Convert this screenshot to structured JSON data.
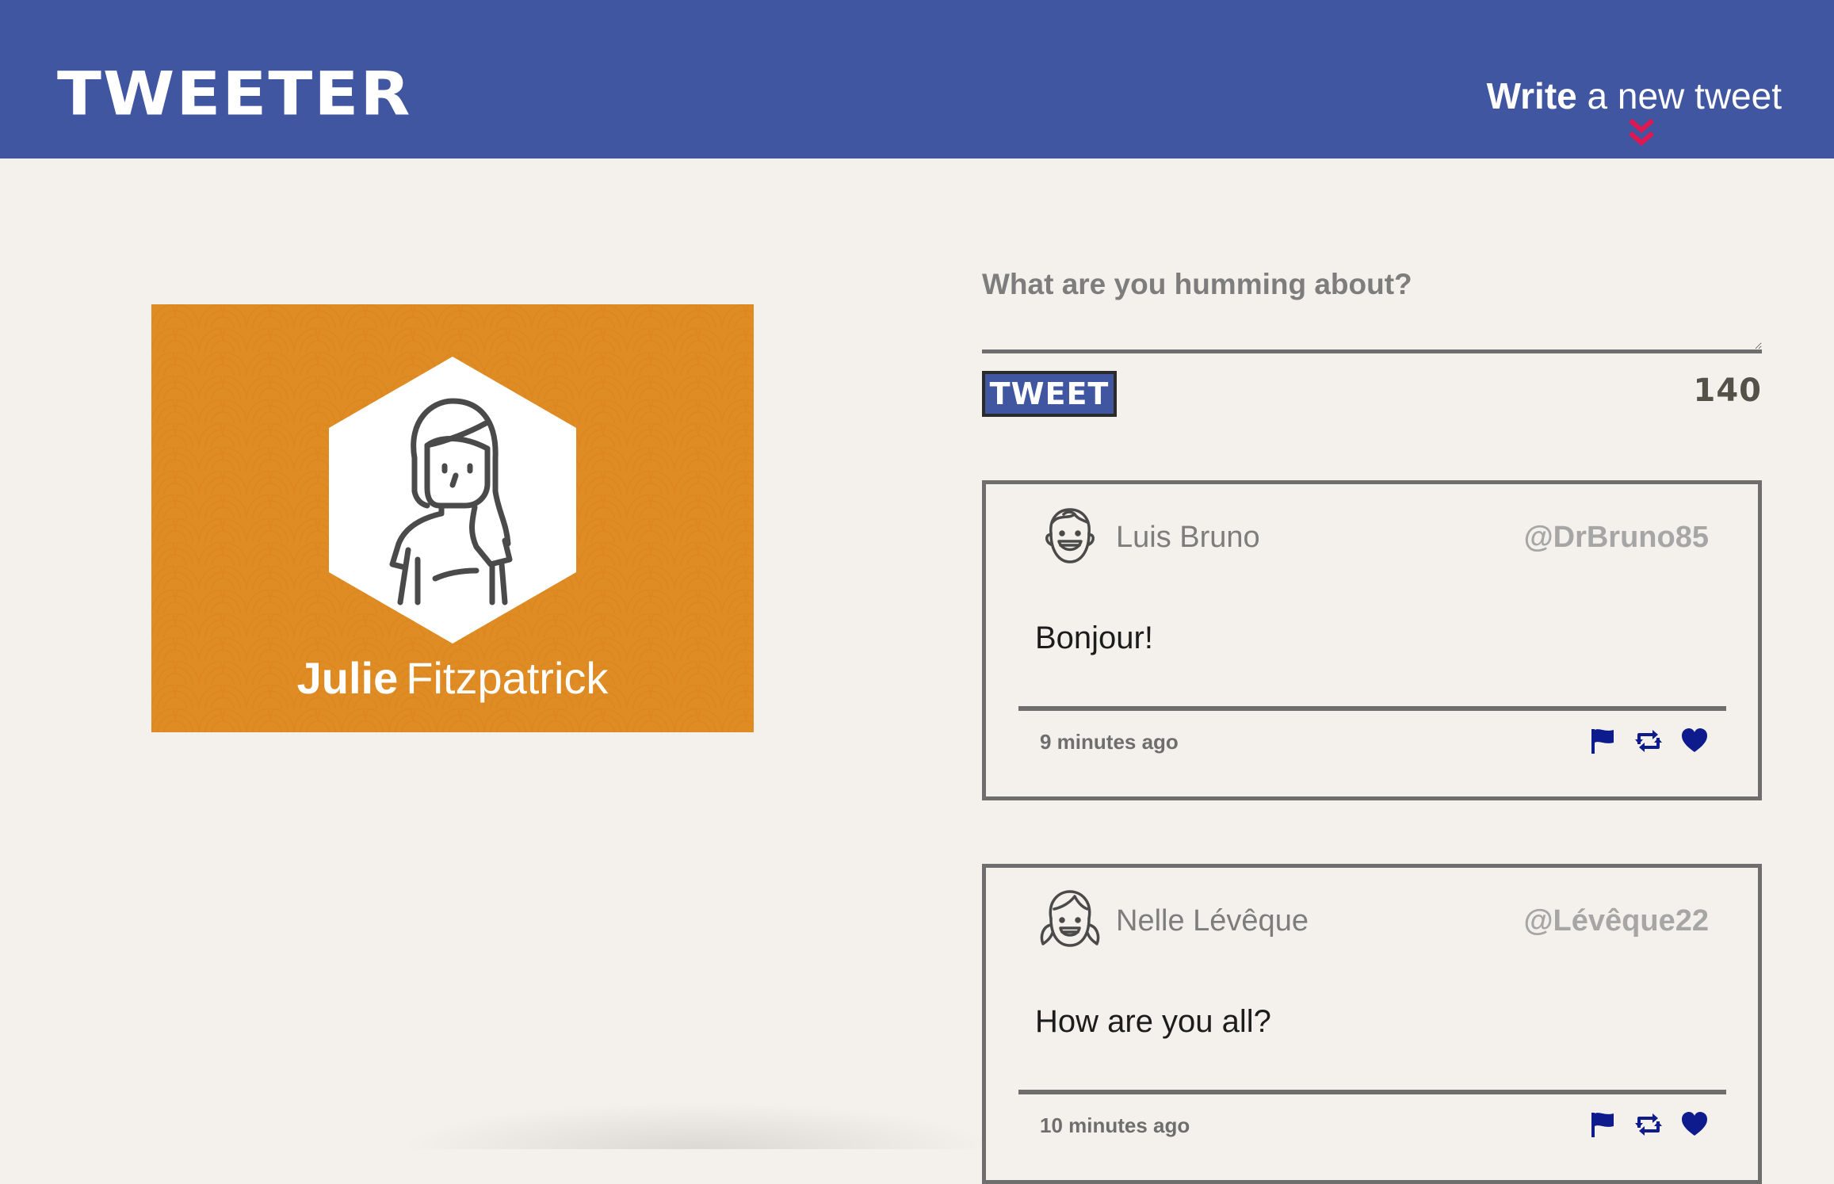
{
  "nav": {
    "logo": "TWEETER",
    "compose_bold": "Write",
    "compose_rest": "a new tweet"
  },
  "profile": {
    "first_name": "Julie",
    "last_name": "Fitzpatrick",
    "avatar_icon": "woman-avatar-icon"
  },
  "new_tweet": {
    "prompt": "What are you humming about?",
    "textarea_value": "",
    "button_label": "TWEET",
    "counter": "140"
  },
  "tweets": [
    {
      "name": "Luis Bruno",
      "handle": "@DrBruno85",
      "text": "Bonjour!",
      "time": "9 minutes ago",
      "avatar_icon": "boy-avatar-icon"
    },
    {
      "name": "Nelle Lévêque",
      "handle": "@Lévêque22",
      "text": "How are you all?",
      "time": "10 minutes ago",
      "avatar_icon": "girl-avatar-icon"
    }
  ],
  "colors": {
    "nav_bg": "#4056a1",
    "page_bg": "#f4f1ec",
    "profile_bg": "#e08c24",
    "accent_arrow": "#e0184f",
    "action_icons": "#0d1b8c"
  }
}
